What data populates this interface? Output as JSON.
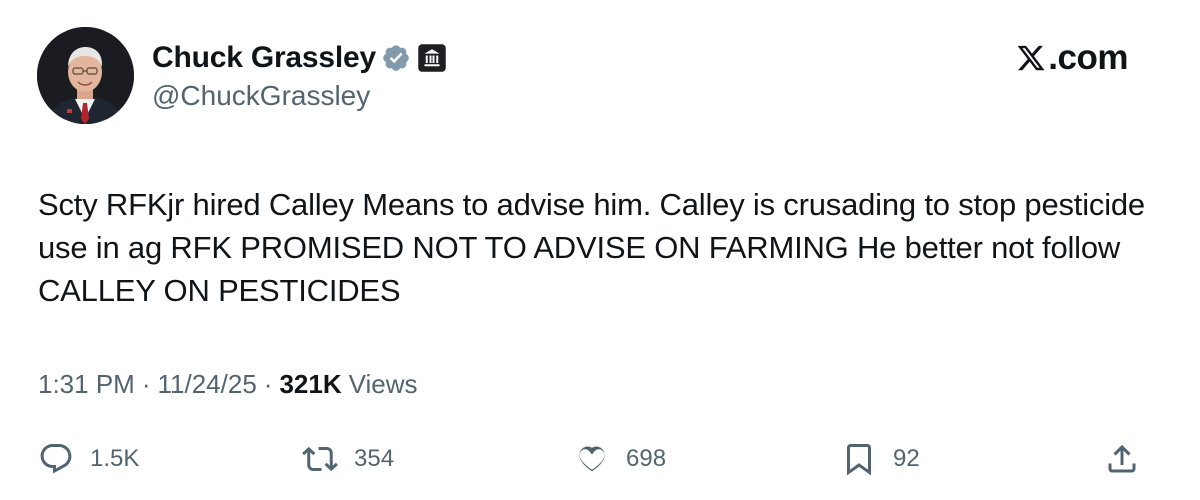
{
  "author": {
    "display_name": "Chuck Grassley",
    "handle": "@ChuckGrassley",
    "verified_icon": "verified-badge-icon",
    "affiliation_icon": "government-building-icon",
    "avatar_icon": "profile-photo"
  },
  "brand": {
    "label": ".com",
    "icon": "x-logo-icon"
  },
  "tweet": {
    "text": "Scty RFKjr hired Calley Means to advise him. Calley is crusading to stop pesticide use in ag RFK PROMISED NOT TO ADVISE ON FARMING He better not follow CALLEY ON PESTICIDES"
  },
  "meta": {
    "time": "1:31 PM",
    "separator": "·",
    "date": "11/24/25",
    "views_count": "321K",
    "views_label": "Views"
  },
  "actions": {
    "reply": {
      "icon": "reply-icon",
      "count": "1.5K"
    },
    "repost": {
      "icon": "repost-icon",
      "count": "354"
    },
    "like": {
      "icon": "heart-icon",
      "count": "698"
    },
    "bookmark": {
      "icon": "bookmark-icon",
      "count": "92"
    },
    "share": {
      "icon": "share-icon"
    }
  },
  "colors": {
    "text_primary": "#0f1419",
    "text_secondary": "#536471",
    "verified_badge": "#829aab",
    "affiliation_badge": "#1d1f23"
  }
}
